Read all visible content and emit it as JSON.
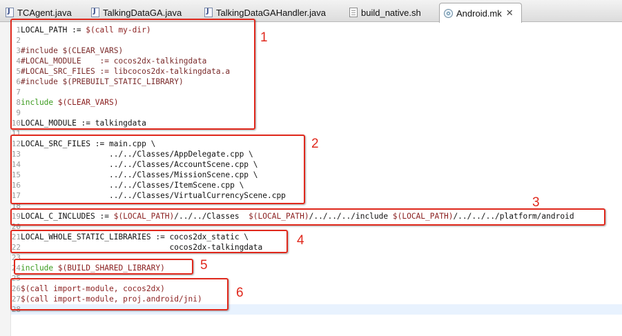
{
  "tabs": [
    {
      "label": "TCAgent.java",
      "icon": "java-file-icon",
      "active": false
    },
    {
      "label": "TalkingDataGA.java",
      "icon": "java-file-icon",
      "active": false
    },
    {
      "label": "TalkingDataGAHandler.java",
      "icon": "java-file-icon",
      "active": false
    },
    {
      "label": "build_native.sh",
      "icon": "shell-file-icon",
      "active": false
    },
    {
      "label": "Android.mk",
      "icon": "makefile-icon",
      "active": true,
      "close": "✕"
    }
  ],
  "code_lines": [
    {
      "n": "1",
      "parts": [
        {
          "t": "LOCAL_PATH := ",
          "c": "code"
        },
        {
          "t": "$(call my-dir)",
          "c": "ref"
        }
      ]
    },
    {
      "n": "2",
      "parts": []
    },
    {
      "n": "3",
      "parts": [
        {
          "t": "#include $(CLEAR_VARS)",
          "c": "cmt"
        }
      ]
    },
    {
      "n": "4",
      "parts": [
        {
          "t": "#LOCAL_MODULE    := cocos2dx-talkingdata",
          "c": "cmt"
        }
      ]
    },
    {
      "n": "5",
      "parts": [
        {
          "t": "#LOCAL_SRC_FILES := libcocos2dx-talkingdata.a",
          "c": "cmt"
        }
      ]
    },
    {
      "n": "6",
      "parts": [
        {
          "t": "#include $(PREBUILT_STATIC_LIBRARY)",
          "c": "cmt"
        }
      ]
    },
    {
      "n": "7",
      "parts": []
    },
    {
      "n": "8",
      "parts": [
        {
          "t": "include ",
          "c": "kw"
        },
        {
          "t": "$(CLEAR_VARS)",
          "c": "ref"
        }
      ]
    },
    {
      "n": "9",
      "parts": []
    },
    {
      "n": "10",
      "parts": [
        {
          "t": "LOCAL_MODULE := talkingdata",
          "c": "code"
        }
      ]
    },
    {
      "n": "11",
      "parts": []
    },
    {
      "n": "12",
      "parts": [
        {
          "t": "LOCAL_SRC_FILES := main.cpp \\",
          "c": "code"
        }
      ]
    },
    {
      "n": "13",
      "parts": [
        {
          "t": "                   ../../Classes/AppDelegate.cpp \\",
          "c": "code"
        }
      ]
    },
    {
      "n": "14",
      "parts": [
        {
          "t": "                   ../../Classes/AccountScene.cpp \\",
          "c": "code"
        }
      ]
    },
    {
      "n": "15",
      "parts": [
        {
          "t": "                   ../../Classes/MissionScene.cpp \\",
          "c": "code"
        }
      ]
    },
    {
      "n": "16",
      "parts": [
        {
          "t": "                   ../../Classes/ItemScene.cpp \\",
          "c": "code"
        }
      ]
    },
    {
      "n": "17",
      "parts": [
        {
          "t": "                   ../../Classes/VirtualCurrencyScene.cpp",
          "c": "code"
        }
      ]
    },
    {
      "n": "18",
      "parts": []
    },
    {
      "n": "19",
      "parts": [
        {
          "t": "LOCAL_C_INCLUDES := ",
          "c": "code"
        },
        {
          "t": "$(LOCAL_PATH)",
          "c": "ref"
        },
        {
          "t": "/../../Classes  ",
          "c": "code"
        },
        {
          "t": "$(LOCAL_PATH)",
          "c": "ref"
        },
        {
          "t": "/../../../include ",
          "c": "code"
        },
        {
          "t": "$(LOCAL_PATH)",
          "c": "ref"
        },
        {
          "t": "/../../../platform/android",
          "c": "code"
        }
      ]
    },
    {
      "n": "20",
      "parts": []
    },
    {
      "n": "21",
      "parts": [
        {
          "t": "LOCAL_WHOLE_STATIC_LIBRARIES := cocos2dx_static \\",
          "c": "code"
        }
      ]
    },
    {
      "n": "22",
      "parts": [
        {
          "t": "                                cocos2dx-talkingdata",
          "c": "code"
        }
      ]
    },
    {
      "n": "23",
      "parts": []
    },
    {
      "n": "24",
      "parts": [
        {
          "t": "include ",
          "c": "kw"
        },
        {
          "t": "$(BUILD_SHARED_LIBRARY)",
          "c": "ref"
        }
      ]
    },
    {
      "n": "25",
      "parts": []
    },
    {
      "n": "26",
      "parts": [
        {
          "t": "$(call import-module, cocos2dx)",
          "c": "ref"
        }
      ]
    },
    {
      "n": "27",
      "parts": [
        {
          "t": "$(call import-module, proj.android/jni)",
          "c": "ref"
        }
      ]
    },
    {
      "n": "28",
      "parts": []
    }
  ],
  "annotations": [
    "1",
    "2",
    "3",
    "4",
    "5",
    "6"
  ],
  "colors": {
    "annotation_red": "#e0281c",
    "keyword_green": "#3c9b1e",
    "variable_dark_red": "#8a1e1e",
    "comment": "#7a2a2a",
    "current_line": "#e8f2fe"
  }
}
